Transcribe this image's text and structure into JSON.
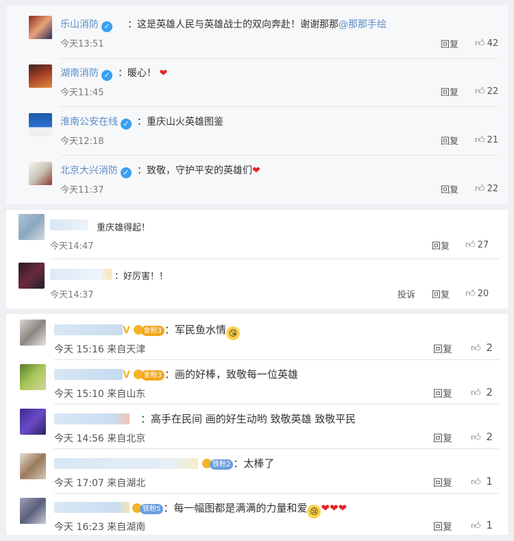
{
  "official": [
    {
      "name": "乐山消防",
      "message_prefix": "：这是英雄人民与英雄战士的双向奔赴！谢谢那那",
      "mention": "@那那手绘",
      "time": "今天13:51",
      "reply": "回复",
      "likes": "42"
    },
    {
      "name": "湖南消防",
      "message": "：暖心！",
      "time": "今天11:45",
      "reply": "回复",
      "likes": "22"
    },
    {
      "name": "淮南公安在线",
      "message": "：重庆山火英雄图鉴",
      "time": "今天12:18",
      "reply": "回复",
      "likes": "21"
    },
    {
      "name": "北京大兴消防",
      "message": "：致敬，守护平安的英雄们",
      "time": "今天11:37",
      "reply": "回复",
      "likes": "22"
    }
  ],
  "middle": [
    {
      "message": "重庆雄得起！",
      "time": "今天14:47",
      "reply": "回复",
      "likes": "27"
    },
    {
      "message": "：好厉害！！",
      "time": "今天14:37",
      "report": "投诉",
      "reply": "回复",
      "likes": "20"
    }
  ],
  "fans": [
    {
      "badge": "金粉3",
      "message": "：军民鱼水情",
      "time": "今天 15:16 来自天津",
      "reply": "回复",
      "likes": "2"
    },
    {
      "badge": "金粉3",
      "message": "：画的好棒，致敬每一位英雄",
      "time": "今天 15:10 来自山东",
      "reply": "回复",
      "likes": "2"
    },
    {
      "message": "：高手在民间 画的好生动哟 致敬英雄 致敬平民",
      "time": "今天 14:56 来自北京",
      "reply": "回复",
      "likes": "2"
    },
    {
      "badge": "铁粉2",
      "message": "：太棒了",
      "time": "今天 17:07 来自湖北",
      "reply": "回复",
      "likes": "1"
    },
    {
      "badge": "铁粉5",
      "message": "：每一幅图都是满满的力量和爱",
      "time": "今天 16:23 来自湖南",
      "reply": "回复",
      "likes": "1"
    }
  ],
  "icons": {
    "verified": "verified-v-icon",
    "like": "thumbs-up-icon",
    "heart": "red-heart-icon"
  }
}
